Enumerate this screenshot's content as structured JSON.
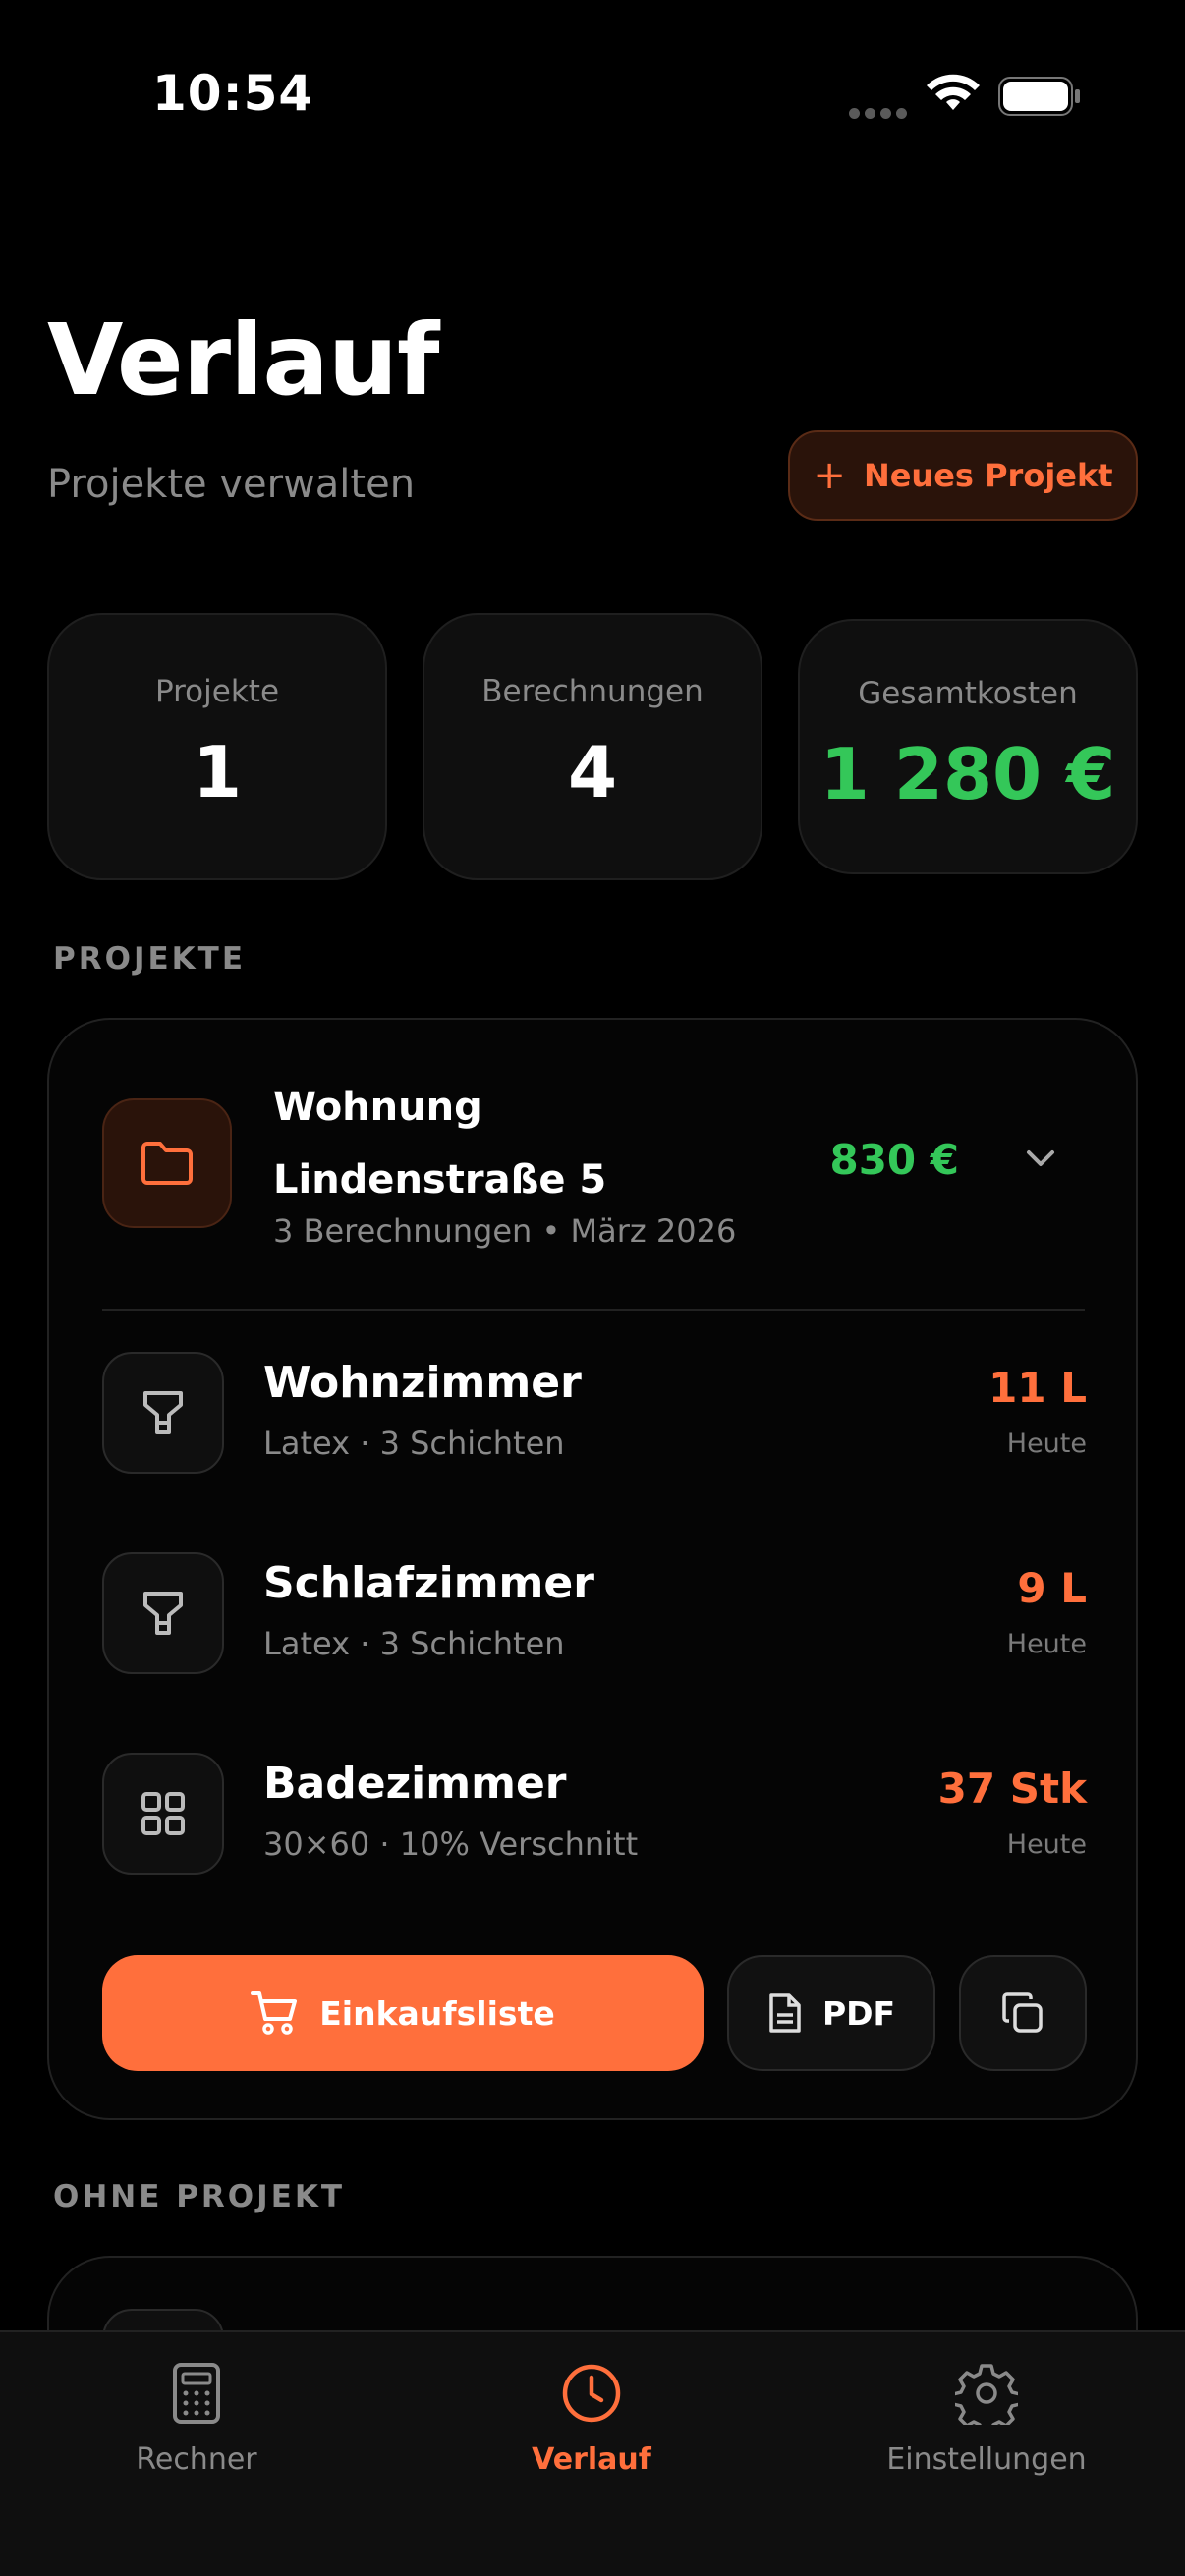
{
  "status": {
    "time": "10:54"
  },
  "header": {
    "title": "Verlauf",
    "subtitle": "Projekte verwalten",
    "new_project_label": "Neues Projekt"
  },
  "stats": [
    {
      "label": "Projekte",
      "value": "1"
    },
    {
      "label": "Berechnungen",
      "value": "4"
    },
    {
      "label": "Gesamtkosten",
      "value": "1 280 €"
    }
  ],
  "sections": {
    "projects": "PROJEKTE",
    "no_project": "OHNE PROJEKT"
  },
  "project": {
    "name": "Wohnung Lindenstraße 5",
    "meta": "3 Berechnungen • März 2026",
    "cost": "830 €",
    "items": [
      {
        "name": "Wohnzimmer",
        "sub": "Latex · 3 Schichten",
        "value": "11 L",
        "date": "Heute",
        "icon": "paint-roller-icon"
      },
      {
        "name": "Schlafzimmer",
        "sub": "Latex · 3 Schichten",
        "value": "9 L",
        "date": "Heute",
        "icon": "paint-roller-icon"
      },
      {
        "name": "Badezimmer",
        "sub": "30×60 · 10% Verschnitt",
        "value": "37 Stk",
        "date": "Heute",
        "icon": "tiles-grid-icon"
      }
    ],
    "actions": {
      "shopping_list": "Einkaufsliste",
      "pdf": "PDF"
    }
  },
  "tabs": [
    {
      "label": "Rechner",
      "icon": "calculator-icon"
    },
    {
      "label": "Verlauf",
      "icon": "clock-icon"
    },
    {
      "label": "Einstellungen",
      "icon": "gear-icon"
    }
  ],
  "colors": {
    "accent": "#ff6f3c",
    "positive": "#34c759",
    "background": "#000000"
  }
}
